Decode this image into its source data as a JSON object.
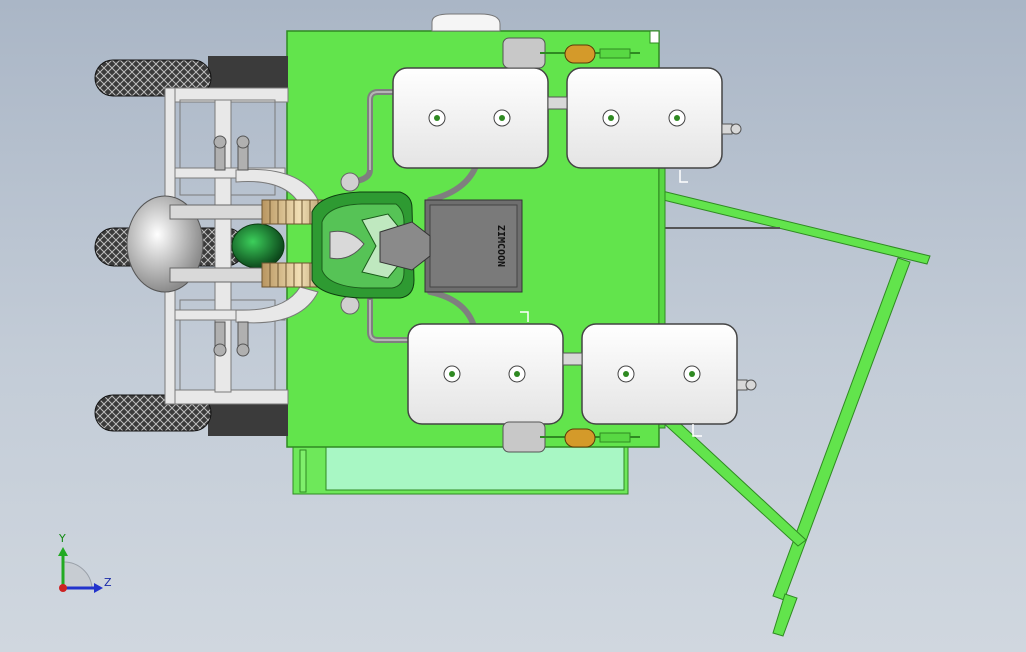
{
  "app": {
    "title": "",
    "view": "Top view"
  },
  "model": {
    "engine_label": "ZIMCOON",
    "colors": {
      "frame_green": "#62e44c",
      "frame_green_dark": "#2f8a22",
      "panel_light_green": "#a8f7c4",
      "tank_white": "#f7f7f7",
      "tire_dark": "#2a2a2a",
      "steel": "#c9c9c9",
      "engine_grey": "#6a6a6a"
    }
  },
  "triad": {
    "y_label": "Y",
    "z_label": "Z",
    "colors": {
      "y": "#22aa22",
      "z": "#2233cc",
      "origin": "#cc2222"
    }
  }
}
